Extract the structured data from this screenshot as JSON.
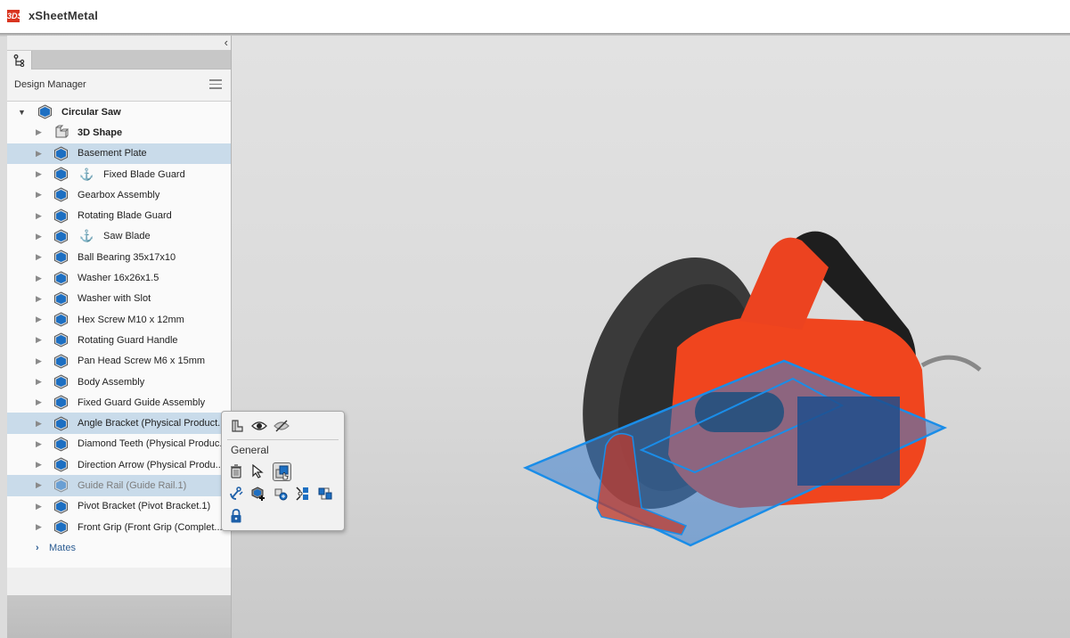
{
  "app": {
    "title": "xSheetMetal",
    "logo_glyph": "3DS"
  },
  "panel": {
    "collapse_icon": "‹",
    "tab_icon": "tree-icon",
    "title": "Design Manager",
    "menu_icon": "hamburger-icon"
  },
  "tree": {
    "root": {
      "label": "Circular Saw",
      "expanded": true
    },
    "items": [
      {
        "label": "3D Shape",
        "icon": "shape-icon",
        "bold": true,
        "selected": false,
        "anchored": false,
        "hidden": false
      },
      {
        "label": "Basement Plate",
        "icon": "part-icon",
        "bold": false,
        "selected": true,
        "anchored": false,
        "hidden": false
      },
      {
        "label": "Fixed Blade Guard",
        "icon": "part-icon",
        "bold": false,
        "selected": false,
        "anchored": true,
        "hidden": false
      },
      {
        "label": "Gearbox Assembly",
        "icon": "part-icon",
        "bold": false,
        "selected": false,
        "anchored": false,
        "hidden": false
      },
      {
        "label": "Rotating Blade Guard",
        "icon": "part-icon",
        "bold": false,
        "selected": false,
        "anchored": false,
        "hidden": false
      },
      {
        "label": "Saw Blade",
        "icon": "part-icon",
        "bold": false,
        "selected": false,
        "anchored": true,
        "hidden": false
      },
      {
        "label": "Ball Bearing 35x17x10",
        "icon": "part-icon",
        "bold": false,
        "selected": false,
        "anchored": false,
        "hidden": false
      },
      {
        "label": "Washer 16x26x1.5",
        "icon": "part-icon",
        "bold": false,
        "selected": false,
        "anchored": false,
        "hidden": false
      },
      {
        "label": "Washer with Slot",
        "icon": "part-icon",
        "bold": false,
        "selected": false,
        "anchored": false,
        "hidden": false
      },
      {
        "label": "Hex Screw M10 x 12mm",
        "icon": "part-icon",
        "bold": false,
        "selected": false,
        "anchored": false,
        "hidden": false
      },
      {
        "label": "Rotating Guard Handle",
        "icon": "part-icon",
        "bold": false,
        "selected": false,
        "anchored": false,
        "hidden": false
      },
      {
        "label": "Pan Head Screw M6 x 15mm",
        "icon": "part-icon",
        "bold": false,
        "selected": false,
        "anchored": false,
        "hidden": false
      },
      {
        "label": "Body Assembly",
        "icon": "part-icon",
        "bold": false,
        "selected": false,
        "anchored": false,
        "hidden": false
      },
      {
        "label": "Fixed Guard Guide Assembly",
        "icon": "part-icon",
        "bold": false,
        "selected": false,
        "anchored": false,
        "hidden": false
      },
      {
        "label": "Angle Bracket (Physical Product...",
        "icon": "part-icon",
        "bold": false,
        "selected": true,
        "anchored": false,
        "hidden": false
      },
      {
        "label": "Diamond Teeth (Physical Produc...",
        "icon": "part-icon",
        "bold": false,
        "selected": false,
        "anchored": false,
        "hidden": false
      },
      {
        "label": "Direction Arrow (Physical Produ...",
        "icon": "part-icon",
        "bold": false,
        "selected": false,
        "anchored": false,
        "hidden": false
      },
      {
        "label": "Guide Rail (Guide Rail.1)",
        "icon": "part-icon",
        "bold": false,
        "selected": true,
        "anchored": false,
        "hidden": true
      },
      {
        "label": "Pivot Bracket (Pivot Bracket.1)",
        "icon": "part-icon",
        "bold": false,
        "selected": false,
        "anchored": false,
        "hidden": false
      },
      {
        "label": "Front Grip (Front Grip (Complet...",
        "icon": "part-icon",
        "bold": false,
        "selected": false,
        "anchored": false,
        "hidden": false
      }
    ],
    "mates_label": "Mates"
  },
  "popup": {
    "top_icons": [
      "isolate-icon",
      "show-icon",
      "hide-icon"
    ],
    "section_label": "General",
    "row1_icons": [
      "delete-icon",
      "select-icon",
      "replace-component-icon"
    ],
    "row2_icons": [
      "fix-anchor-icon",
      "insert-component-icon",
      "pattern-icon",
      "explode-icon",
      "mate-icon"
    ],
    "row3_icons": [
      "lock-icon"
    ]
  },
  "colors": {
    "accent_blue": "#2a5b91",
    "selection": "#c9dbea",
    "model_orange": "#f0451e",
    "model_highlight": "#1a8de8"
  }
}
